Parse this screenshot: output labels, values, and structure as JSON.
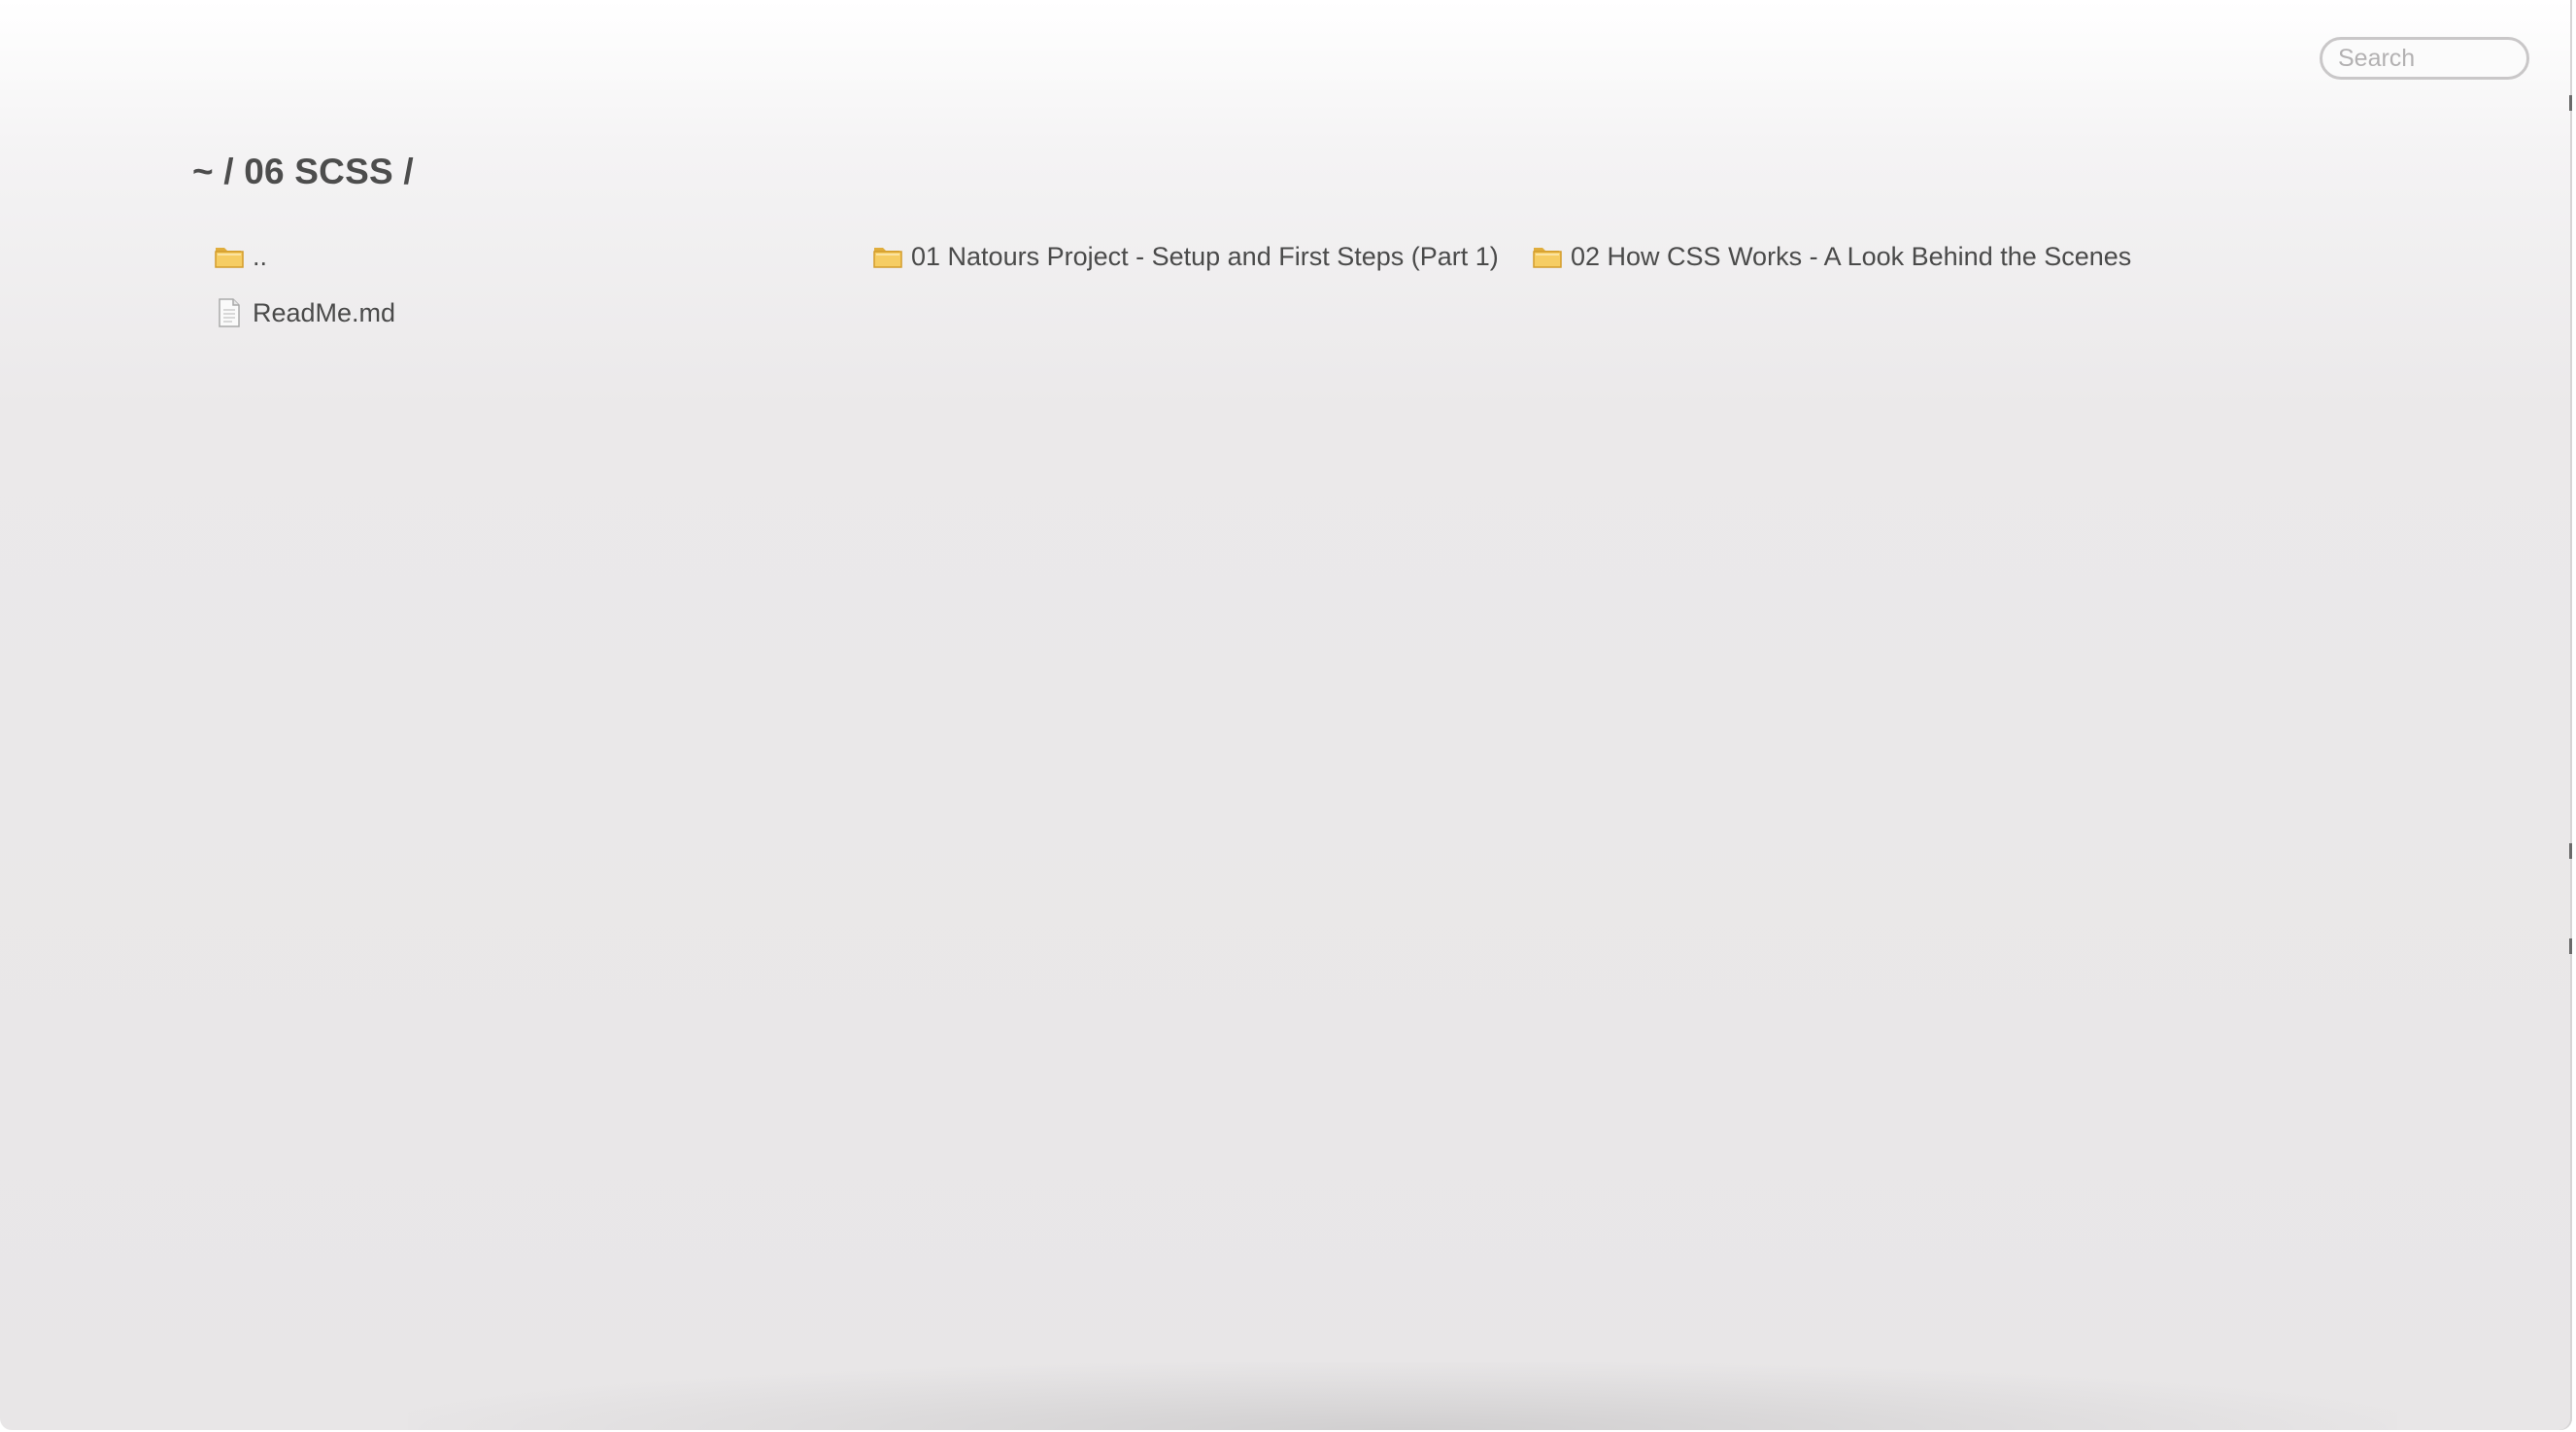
{
  "search": {
    "placeholder": "Search",
    "value": ""
  },
  "breadcrumb": {
    "text": "~ / 06 SCSS /"
  },
  "entries": [
    {
      "type": "folder",
      "icon": "folder-icon",
      "name": ".."
    },
    {
      "type": "folder",
      "icon": "folder-icon",
      "name": "01 Natours Project - Setup and First Steps (Part 1)"
    },
    {
      "type": "folder",
      "icon": "folder-icon",
      "name": "02 How CSS Works - A Look Behind the Scenes"
    },
    {
      "type": "file",
      "icon": "document-icon",
      "name": "ReadMe.md"
    }
  ],
  "colors": {
    "folder": "#f2c34f",
    "folder_dark": "#d9a02a",
    "text": "#4a4a4a",
    "background": "#e9e7e8"
  }
}
